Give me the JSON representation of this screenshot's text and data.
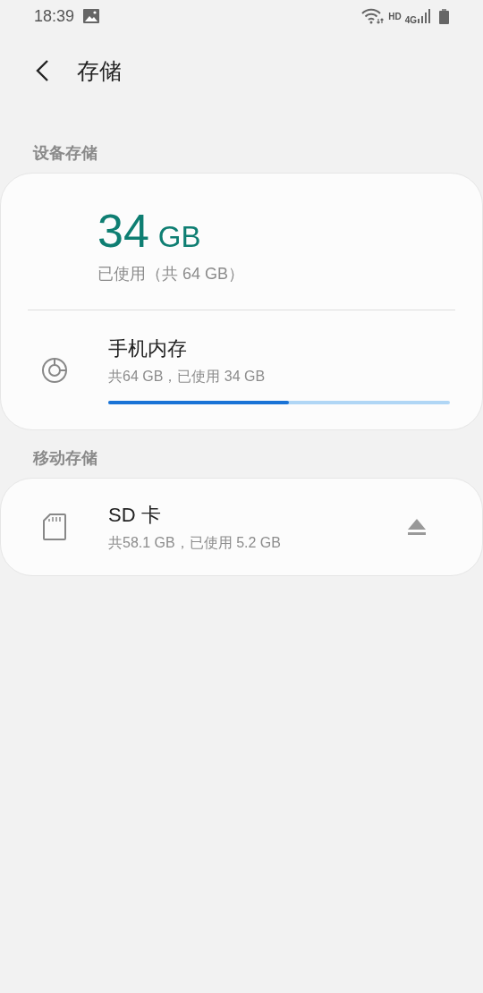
{
  "status_bar": {
    "time": "18:39",
    "network_label": "HD",
    "network_type": "4G"
  },
  "header": {
    "title": "存储"
  },
  "sections": [
    {
      "label": "设备存储",
      "summary": {
        "used_value": "34",
        "used_unit": "GB",
        "caption": "已使用（共 64 GB）"
      },
      "items": [
        {
          "kind": "internal",
          "title": "手机内存",
          "detail": "共64 GB，已使用 34 GB",
          "level": 0.53
        }
      ]
    },
    {
      "label": "移动存储",
      "items": [
        {
          "kind": "sd_card",
          "title": "SD 卡",
          "detail": "共58.1 GB，已使用 5.2 GB",
          "eject": true
        }
      ]
    }
  ]
}
